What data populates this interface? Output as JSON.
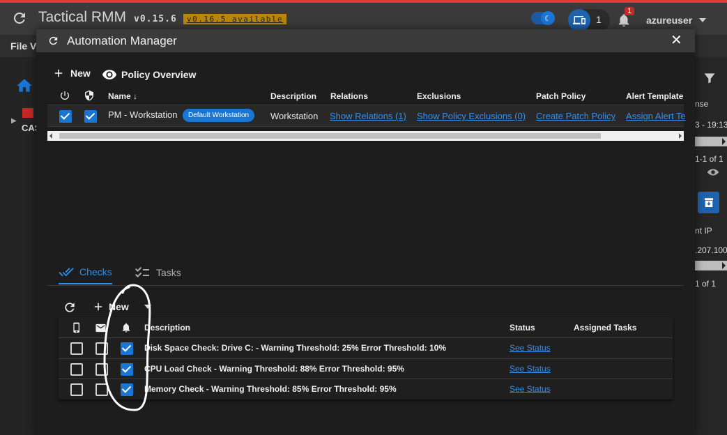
{
  "app": {
    "title": "Tactical RMM",
    "version": "v0.15.6",
    "update_notice": "v0.16.5 available",
    "agents_count": "1",
    "notifications_count": "1",
    "username": "azureuser",
    "menu_file": "File  V",
    "tree_label": "CAS",
    "accent_color": "#1976d2",
    "alert_color": "#e53935"
  },
  "background_right": {
    "col_header": "nse",
    "date_text": "3 - 19:13",
    "pagination_1": "1-1 of 1",
    "agent_ip_header": "nt IP",
    "agent_ip": ".207.100",
    "pagination_2": "1 of 1"
  },
  "modal": {
    "title": "Automation Manager",
    "new_label": "New",
    "policy_overview_label": "Policy Overview",
    "policy_table": {
      "headers": {
        "name": "Name ↓",
        "description": "Description",
        "relations": "Relations",
        "exclusions": "Exclusions",
        "patch_policy": "Patch Policy",
        "alert_template": "Alert Template"
      },
      "rows": [
        {
          "enabled": true,
          "enforced": true,
          "name": "PM - Workstation",
          "chip": "Default Workstation",
          "description": "Workstation",
          "relations": "Show Relations (1)",
          "exclusions": "Show Policy Exclusions (0)",
          "patch_policy": "Create Patch Policy",
          "alert_template": "Assign Alert Te"
        }
      ]
    },
    "tabs": [
      {
        "label": "Checks",
        "active": true
      },
      {
        "label": "Tasks",
        "active": false
      }
    ],
    "checks_toolbar": {
      "new_label": "New"
    },
    "checks_table": {
      "headers": {
        "description": "Description",
        "status": "Status",
        "assigned_tasks": "Assigned Tasks"
      },
      "rows": [
        {
          "text_alert": false,
          "email_alert": false,
          "dashboard_alert": true,
          "description": "Disk Space Check: Drive C: - Warning Threshold: 25% Error Threshold: 10%",
          "status": "See Status",
          "assigned_tasks": ""
        },
        {
          "text_alert": false,
          "email_alert": false,
          "dashboard_alert": true,
          "description": "CPU Load Check - Warning Threshold: 88% Error Threshold: 95%",
          "status": "See Status",
          "assigned_tasks": ""
        },
        {
          "text_alert": false,
          "email_alert": false,
          "dashboard_alert": true,
          "description": "Memory Check - Warning Threshold: 85% Error Threshold: 95%",
          "status": "See Status",
          "assigned_tasks": ""
        }
      ]
    }
  }
}
